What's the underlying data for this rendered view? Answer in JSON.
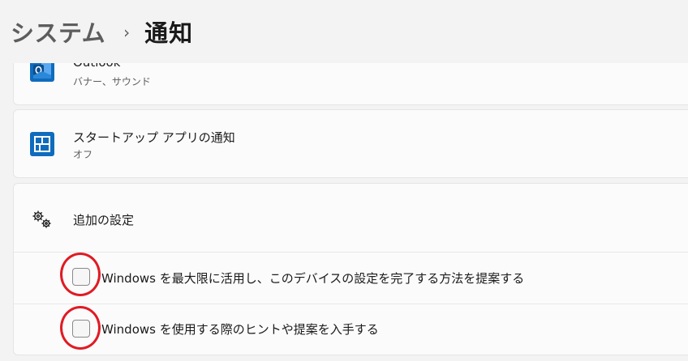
{
  "breadcrumb": {
    "parent": "システム",
    "separator": "›",
    "current": "通知"
  },
  "apps": [
    {
      "name": "Outlook",
      "status": "バナー、サウンド",
      "icon": "outlook-icon",
      "icon_color": "#0f6cbd"
    },
    {
      "name": "スタートアップ アプリの通知",
      "status": "オフ",
      "icon": "startup-apps-icon",
      "icon_color": "#0f6cbd"
    }
  ],
  "additional": {
    "title": "追加の設定",
    "icon": "gears-icon",
    "options": [
      {
        "label": "Windows を最大限に活用し、このデバイスの設定を完了する方法を提案する",
        "checked": false
      },
      {
        "label": "Windows を使用する際のヒントや提案を入手する",
        "checked": false
      }
    ]
  },
  "annotation_color": "#e01b24"
}
